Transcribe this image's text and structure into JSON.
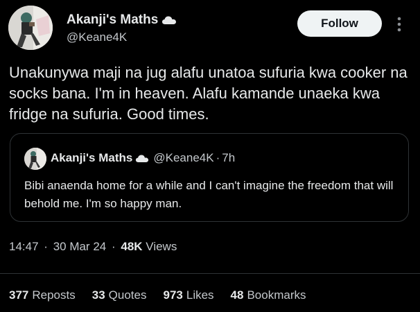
{
  "tweet": {
    "author_name": "Akanji's Maths",
    "author_handle": "@Keane4K",
    "follow_label": "Follow",
    "more_icon": "more-vertical-icon",
    "body": "Unakunywa maji na jug alafu unatoa sufuria kwa cooker na socks bana. I'm in heaven. Alafu kamande unaeka kwa fridge na sufuria. Good times."
  },
  "quote": {
    "author_name": "Akanji's Maths",
    "author_handle": "@Keane4K",
    "separator": "·",
    "time_ago": "7h",
    "body": "Bibi anaenda home for a while and I can't imagine the freedom that will behold me. I'm so happy man."
  },
  "meta": {
    "time": "14:47",
    "separator": "·",
    "date": "30 Mar 24",
    "views_count": "48K",
    "views_label": "Views"
  },
  "stats": {
    "reposts_count": "377",
    "reposts_label": "Reposts",
    "quotes_count": "33",
    "quotes_label": "Quotes",
    "likes_count": "973",
    "likes_label": "Likes",
    "bookmarks_count": "48",
    "bookmarks_label": "Bookmarks"
  },
  "colors": {
    "background": "#000000",
    "text_primary": "#e7e9ea",
    "text_secondary": "#c4c8cc",
    "border": "#2f3336",
    "follow_bg": "#eff3f4"
  }
}
